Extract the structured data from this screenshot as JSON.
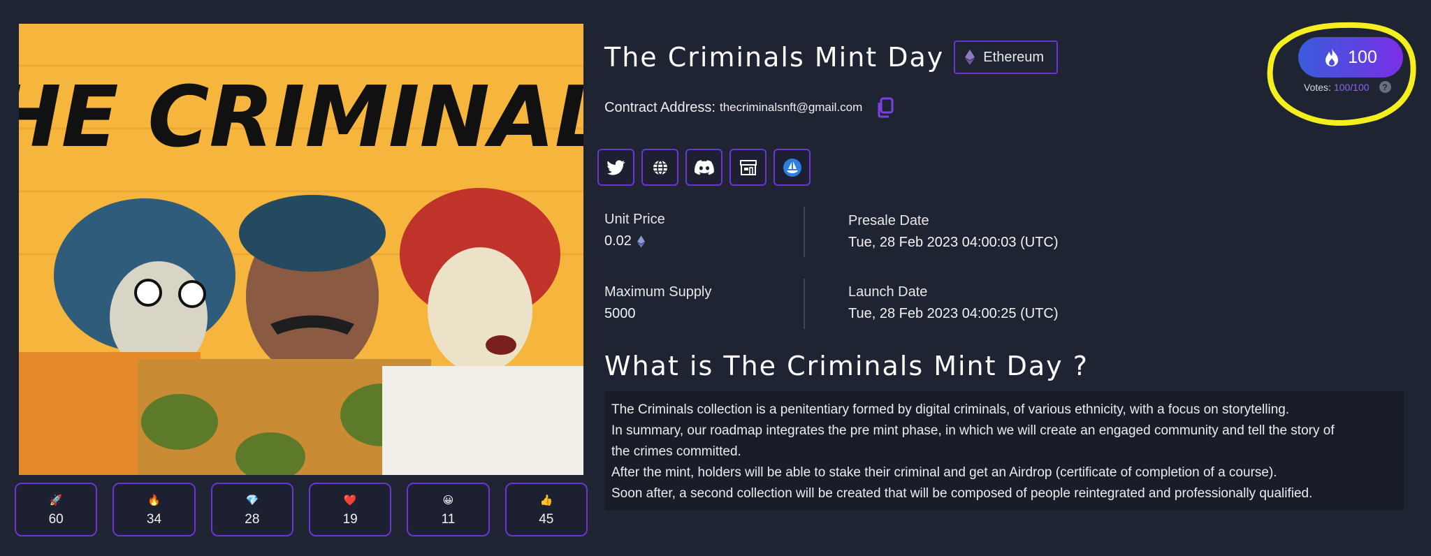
{
  "project": {
    "title": "The Criminals Mint Day",
    "chain": "Ethereum",
    "contract_label": "Contract Address:",
    "contract_value": "thecriminalsnft@gmail.com",
    "artwork_text": "THE CRIMINALS"
  },
  "socials": [
    {
      "name": "twitter-icon"
    },
    {
      "name": "globe-icon"
    },
    {
      "name": "discord-icon"
    },
    {
      "name": "marketplace-icon"
    },
    {
      "name": "opensea-icon"
    }
  ],
  "stats": {
    "unit_price_label": "Unit Price",
    "unit_price_value": "0.02",
    "presale_label": "Presale Date",
    "presale_value": "Tue, 28 Feb 2023 04:00:03 (UTC)",
    "supply_label": "Maximum Supply",
    "supply_value": "5000",
    "launch_label": "Launch Date",
    "launch_value": "Tue, 28 Feb 2023 04:00:25 (UTC)"
  },
  "about": {
    "heading": "What is The Criminals Mint Day ?",
    "lines": [
      "The Criminals collection is a penitentiary formed by digital criminals, of various ethnicity, with a focus on storytelling.",
      "In summary, our roadmap integrates the pre mint phase, in which we will create an engaged community and tell the story of",
      "the crimes committed.",
      "After the mint, holders will be able to stake their criminal and get an Airdrop (certificate of completion of a course).",
      "Soon after, a second collection will be created that will be composed of people reintegrated and professionally qualified."
    ]
  },
  "reactions": [
    {
      "emoji": "🚀",
      "name": "rocket-icon",
      "count": "60"
    },
    {
      "emoji": "🔥",
      "name": "fire-icon",
      "count": "34"
    },
    {
      "emoji": "💎",
      "name": "diamond-icon",
      "count": "28"
    },
    {
      "emoji": "❤️",
      "name": "heart-icon",
      "count": "19"
    },
    {
      "emoji": "😀",
      "name": "smiley-icon",
      "count": "11"
    },
    {
      "emoji": "👍",
      "name": "thumbs-up-icon",
      "count": "45"
    }
  ],
  "vote": {
    "count": "100",
    "label": "Votes:",
    "value": "100/100",
    "help": "?"
  },
  "colors": {
    "background": "#1f2433",
    "accent": "#6b35d6",
    "highlight": "#f5ef1f",
    "artwork_bg": "#f6b53c"
  }
}
